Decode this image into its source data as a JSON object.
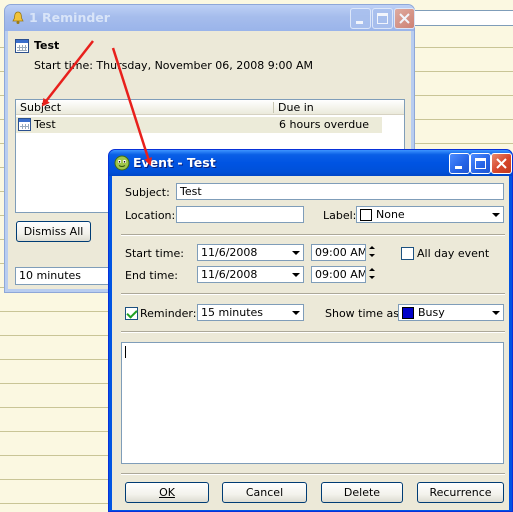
{
  "reminder": {
    "title": "1 Reminder",
    "item_title": "Test",
    "start_line": "Start time: Thursday, November 06, 2008 9:00 AM",
    "columns": [
      "Subject",
      "Due in"
    ],
    "rows": [
      {
        "subject": "Test",
        "due": "6 hours overdue"
      }
    ],
    "dismiss_all_label": "Dismiss All",
    "snooze_value": "10 minutes"
  },
  "event": {
    "title": "Event - Test",
    "subject_label": "Subject:",
    "subject_value": "Test",
    "location_label": "Location:",
    "location_value": "",
    "label_label": "Label:",
    "label_value": "None",
    "label_color": "#ffffff",
    "start_label": "Start time:",
    "start_date": "11/6/2008",
    "start_time": "09:00 AM",
    "end_label": "End time:",
    "end_date": "11/6/2008",
    "end_time": "09:00 AM",
    "all_day_label": "All day event",
    "all_day_checked": false,
    "reminder_label": "Reminder:",
    "reminder_checked": true,
    "reminder_value": "15 minutes",
    "show_time_label": "Show time as:",
    "show_time_value": "Busy",
    "show_time_color": "#0000c8",
    "notes": "",
    "buttons": {
      "ok": "OK",
      "cancel": "Cancel",
      "delete": "Delete",
      "recurrence": "Recurrence"
    }
  },
  "colors": {
    "xp_blue": "#0054e3",
    "annotation_arrow": "#e8201c",
    "dialog_face": "#ece9d8"
  }
}
